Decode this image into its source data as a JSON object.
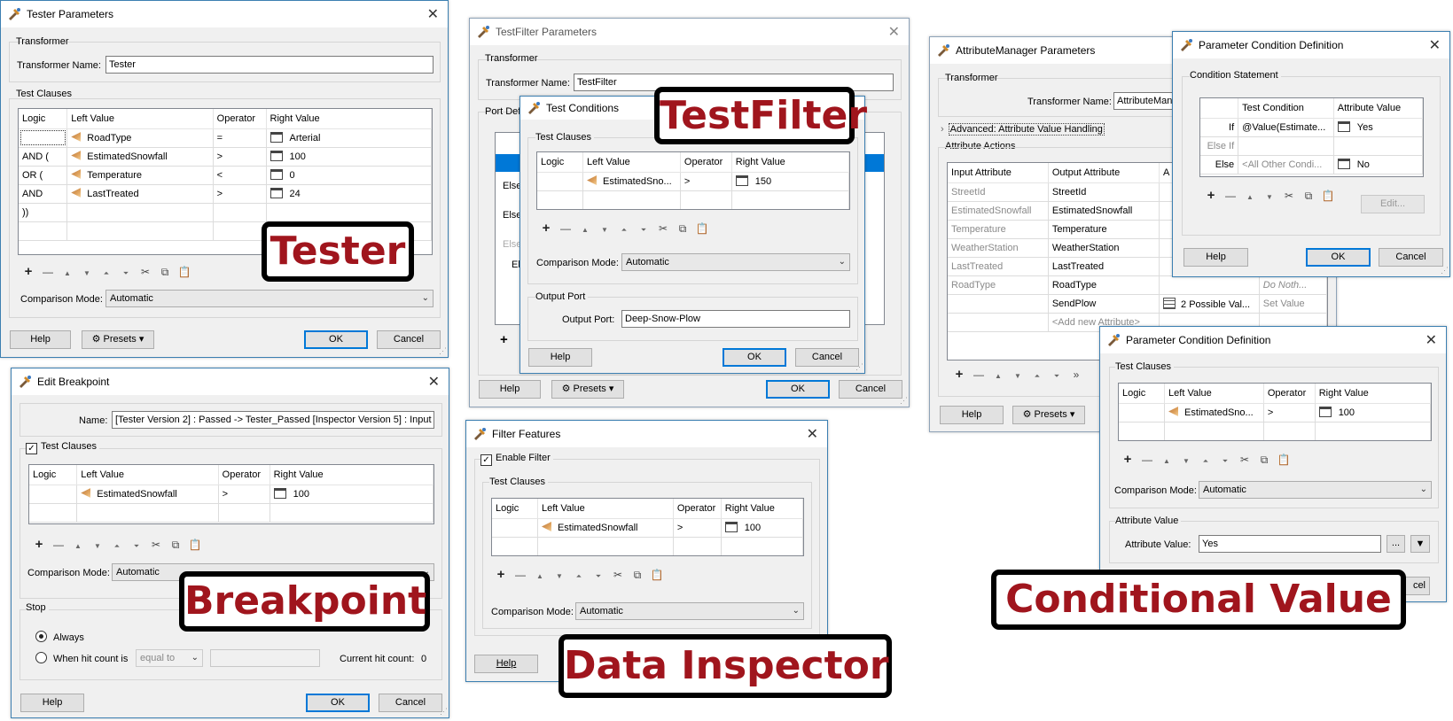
{
  "colors": {
    "accent": "#0078d7",
    "callout_text": "#a0151d",
    "callout_border": "#000000"
  },
  "tester": {
    "title": "Tester Parameters",
    "transformer_group": "Transformer",
    "name_label": "Transformer Name:",
    "name_value": "Tester",
    "clauses_group": "Test Clauses",
    "headers": [
      "Logic",
      "Left Value",
      "Operator",
      "Right Value"
    ],
    "rows": [
      {
        "logic": "",
        "left": "RoadType",
        "op": "=",
        "right": "Arterial"
      },
      {
        "logic": "AND (",
        "left": "EstimatedSnowfall",
        "op": ">",
        "right": "100"
      },
      {
        "logic": "OR (",
        "left": "Temperature",
        "op": "<",
        "right": "0"
      },
      {
        "logic": "AND",
        "left": "LastTreated",
        "op": ">",
        "right": "24"
      },
      {
        "logic": "))",
        "left": "",
        "op": "",
        "right": ""
      }
    ],
    "mode_label": "Comparison Mode:",
    "mode_value": "Automatic",
    "help": "Help",
    "presets": "Presets",
    "ok": "OK",
    "cancel": "Cancel"
  },
  "testfilter": {
    "title": "TestFilter Parameters",
    "transformer_group": "Transformer",
    "name_label": "Transformer Name:",
    "name_value": "TestFilter",
    "port_group": "Port Def",
    "bg_rows": [
      "",
      "Else",
      "Else",
      "Else",
      "Els"
    ],
    "help": "Help",
    "presets": "Presets",
    "ok": "OK",
    "cancel": "Cancel",
    "plus": "+"
  },
  "testconditions": {
    "title": "Test Conditions",
    "clauses_group": "Test Clauses",
    "headers": [
      "Logic",
      "Left Value",
      "Operator",
      "Right Value"
    ],
    "rows": [
      {
        "logic": "",
        "left": "EstimatedSno...",
        "op": ">",
        "right": "150"
      }
    ],
    "mode_label": "Comparison Mode:",
    "mode_value": "Automatic",
    "port_group": "Output Port",
    "port_label": "Output Port:",
    "port_value": "Deep-Snow-Plow",
    "help": "Help",
    "ok": "OK",
    "cancel": "Cancel"
  },
  "attrmanager": {
    "title": "AttributeManager Parameters",
    "transformer_group": "Transformer",
    "name_label": "Transformer Name:",
    "name_value": "AttributeMana",
    "advanced": "Advanced: Attribute Value Handling",
    "actions_group": "Attribute Actions",
    "headers": [
      "Input Attribute",
      "Output Attribute",
      "A"
    ],
    "rows": [
      {
        "input": "StreetId",
        "output": "StreetId",
        "value": "",
        "action": ""
      },
      {
        "input": "EstimatedSnowfall",
        "output": "EstimatedSnowfall",
        "value": "",
        "action": ""
      },
      {
        "input": "Temperature",
        "output": "Temperature",
        "value": "",
        "action": ""
      },
      {
        "input": "WeatherStation",
        "output": "WeatherStation",
        "value": "",
        "action": ""
      },
      {
        "input": "LastTreated",
        "output": "LastTreated",
        "value": "",
        "action": ""
      },
      {
        "input": "RoadType",
        "output": "RoadType",
        "value": "",
        "action": "Do Noth..."
      },
      {
        "input": "",
        "output": "SendPlow",
        "value": "2 Possible Val...",
        "action": "Set Value"
      },
      {
        "input": "",
        "output": "<Add new Attribute>",
        "value": "",
        "action": ""
      }
    ],
    "help": "Help",
    "presets": "Presets",
    "more": "»"
  },
  "pcd1": {
    "title": "Parameter Condition Definition",
    "group": "Condition Statement",
    "headers": [
      "",
      "Test Condition",
      "Attribute Value"
    ],
    "rows": [
      {
        "label": "If",
        "cond": "@Value(Estimate...",
        "value": "Yes"
      },
      {
        "label": "Else If",
        "cond": "",
        "value": ""
      },
      {
        "label": "Else",
        "cond": "<All Other Condi...",
        "value": "No"
      }
    ],
    "edit": "Edit...",
    "help": "Help",
    "ok": "OK",
    "cancel": "Cancel"
  },
  "pcd2": {
    "title": "Parameter Condition Definition",
    "clauses_group": "Test Clauses",
    "headers": [
      "Logic",
      "Left Value",
      "Operator",
      "Right Value"
    ],
    "rows": [
      {
        "logic": "",
        "left": "EstimatedSno...",
        "op": ">",
        "right": "100"
      }
    ],
    "mode_label": "Comparison Mode:",
    "mode_value": "Automatic",
    "value_group": "Attribute Value",
    "value_label": "Attribute Value:",
    "value_value": "Yes",
    "more": "...",
    "cancel_partial": "cel"
  },
  "breakpoint": {
    "title": "Edit Breakpoint",
    "name_label": "Name:",
    "name_value": "[Tester Version 2] : Passed -> Tester_Passed [Inspector Version 5] : Input",
    "clauses_check": "Test Clauses",
    "headers": [
      "Logic",
      "Left Value",
      "Operator",
      "Right Value"
    ],
    "rows": [
      {
        "logic": "",
        "left": "EstimatedSnowfall",
        "op": ">",
        "right": "100"
      }
    ],
    "mode_label": "Comparison Mode:",
    "mode_value": "Automatic",
    "stop_group": "Stop",
    "always": "Always",
    "when": "When hit count is",
    "equal": "equal to",
    "hit_label": "Current hit count:",
    "hit_value": "0",
    "help": "Help",
    "ok": "OK",
    "cancel": "Cancel"
  },
  "filter": {
    "title": "Filter Features",
    "enable": "Enable Filter",
    "clauses_group": "Test Clauses",
    "headers": [
      "Logic",
      "Left Value",
      "Operator",
      "Right Value"
    ],
    "rows": [
      {
        "logic": "",
        "left": "EstimatedSnowfall",
        "op": ">",
        "right": "100"
      }
    ],
    "mode_label": "Comparison Mode:",
    "mode_value": "Automatic",
    "help": "Help"
  },
  "callouts": {
    "tester": "Tester",
    "testfilter": "TestFilter",
    "breakpoint": "Breakpoint",
    "inspector": "Data Inspector",
    "conditional": "Conditional Value"
  }
}
